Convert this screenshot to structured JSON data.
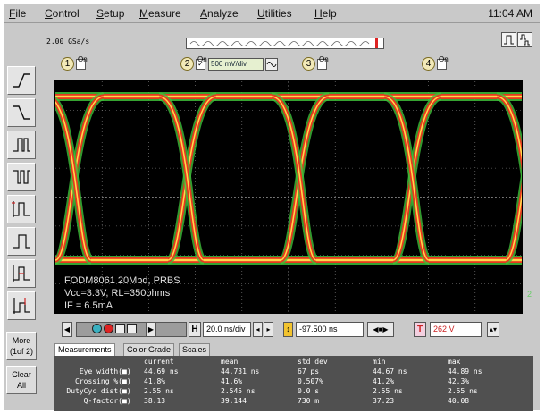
{
  "menu": {
    "items": [
      {
        "label": "File",
        "u": "F",
        "rest": "ile"
      },
      {
        "label": "Control",
        "u": "C",
        "rest": "ontrol"
      },
      {
        "label": "Setup",
        "u": "S",
        "rest": "etup"
      },
      {
        "label": "Measure",
        "u": "M",
        "rest": "easure"
      },
      {
        "label": "Analyze",
        "u": "A",
        "rest": "nalyze"
      },
      {
        "label": "Utilities",
        "u": "U",
        "rest": "tilities"
      },
      {
        "label": "Help",
        "u": "H",
        "rest": "elp"
      }
    ],
    "clock": "11:04 AM"
  },
  "toolbar": {
    "sample_rate": "2.00 GSa/s",
    "channels": [
      {
        "num": "1",
        "on": "On"
      },
      {
        "num": "2",
        "on": "On",
        "scale": "500 mV/div"
      },
      {
        "num": "3",
        "on": "On"
      },
      {
        "num": "4",
        "on": "On"
      }
    ]
  },
  "left_panel": {
    "more": "More",
    "more_sub": "(1of 2)",
    "clear": "Clear",
    "clear_sub": "All"
  },
  "screen": {
    "label_lines": [
      "FODM8061 20Mbd, PRBS",
      "Vcc=3.3V, RL=350ohms",
      "IF = 6.5mA"
    ],
    "channel_marker": "2",
    "colors": {
      "background": "#000000",
      "grid": "#8a8a8a",
      "trace_hot": "#ffd84a",
      "trace_mid": "#e8381e",
      "trace_edge": "#3fbf3a"
    }
  },
  "time_controls": {
    "h_label": "H",
    "timebase": "20.0 ns/div",
    "delay": "-97.500 ns",
    "t_label": "T",
    "trigger_level": "262 V"
  },
  "measurements": {
    "tabs": [
      "Measurements",
      "Color Grade",
      "Scales"
    ],
    "columns": [
      "current",
      "mean",
      "std dev",
      "min",
      "max"
    ],
    "rows": [
      {
        "label": "Eye width(",
        "current": "44.69 ns",
        "mean": "44.731 ns",
        "std": "67 ps",
        "min": "44.67 ns",
        "max": "44.89 ns"
      },
      {
        "label": "Crossing %(",
        "current": "41.8%",
        "mean": "41.6%",
        "std": "0.507%",
        "min": "41.2%",
        "max": "42.3%"
      },
      {
        "label": "DutyCyc dist(",
        "current": "2.55 ns",
        "mean": "2.545 ns",
        "std": "0.0 s",
        "min": "2.55 ns",
        "max": "2.55 ns"
      },
      {
        "label": "Q-factor(",
        "current": "38.13",
        "mean": "39.144",
        "std": "730 m",
        "min": "37.23",
        "max": "40.08"
      }
    ]
  }
}
